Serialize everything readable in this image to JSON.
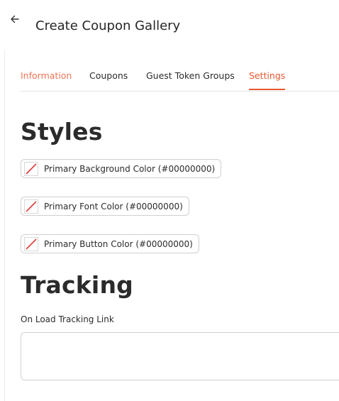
{
  "header": {
    "back_icon": "arrow-left-icon",
    "title": "Create Coupon Gallery"
  },
  "tabs": [
    {
      "label": "Information"
    },
    {
      "label": "Coupons"
    },
    {
      "label": "Guest Token Groups"
    },
    {
      "label": "Settings"
    }
  ],
  "styles": {
    "title": "Styles",
    "colors": [
      {
        "label": "Primary Background Color (#00000000)",
        "value": "#00000000"
      },
      {
        "label": "Primary Font Color (#00000000)",
        "value": "#00000000"
      },
      {
        "label": "Primary Button Color (#00000000)",
        "value": "#00000000"
      }
    ]
  },
  "tracking": {
    "title": "Tracking",
    "on_load_label": "On Load Tracking Link",
    "on_load_value": ""
  },
  "theme": {
    "accent": "#e9572f",
    "accent_light": "#ef7455",
    "swatch_slash": "#e23b3b"
  }
}
